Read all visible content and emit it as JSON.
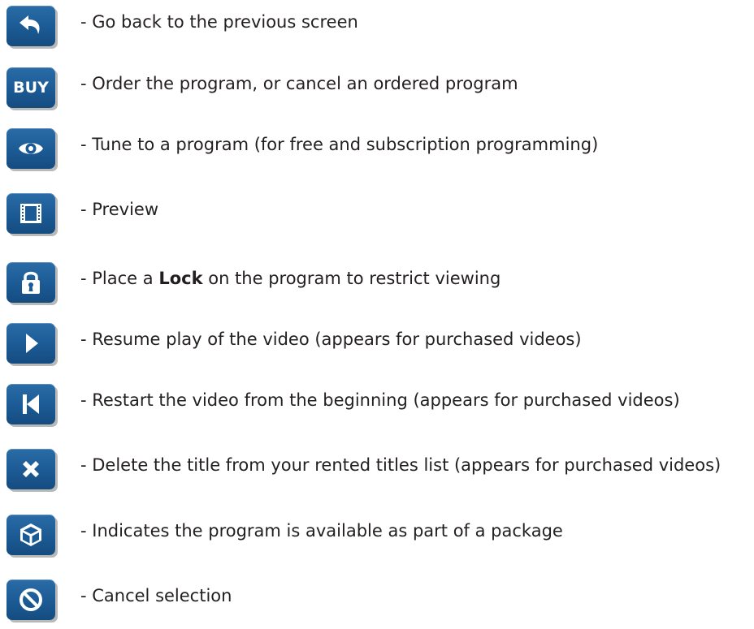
{
  "legend": {
    "items": [
      {
        "icon": "back-arrow-icon",
        "text": "- Go back to the previous screen"
      },
      {
        "icon": "buy-icon",
        "icon_label": "BUY",
        "text": "- Order the program, or cancel an ordered program"
      },
      {
        "icon": "eye-icon",
        "text": "- Tune to a program (for free and subscription programming)"
      },
      {
        "icon": "film-icon",
        "text": "- Preview"
      },
      {
        "icon": "lock-icon",
        "text_before": "- Place a ",
        "text_bold": "Lock",
        "text_after": " on the program to restrict viewing"
      },
      {
        "icon": "play-icon",
        "text": "- Resume play of the video (appears for purchased videos)"
      },
      {
        "icon": "restart-icon",
        "text": "- Restart the video from the beginning (appears for purchased videos)"
      },
      {
        "icon": "delete-icon",
        "text": "- Delete the title from your rented titles list (appears for purchased videos)"
      },
      {
        "icon": "package-box-icon",
        "text": "- Indicates the program is available as part of a package"
      },
      {
        "icon": "cancel-icon",
        "text": "- Cancel selection"
      }
    ]
  },
  "colors": {
    "button_blue": "#1b5a94",
    "button_shadow": "#b9b9b9",
    "text": "#231f20"
  }
}
